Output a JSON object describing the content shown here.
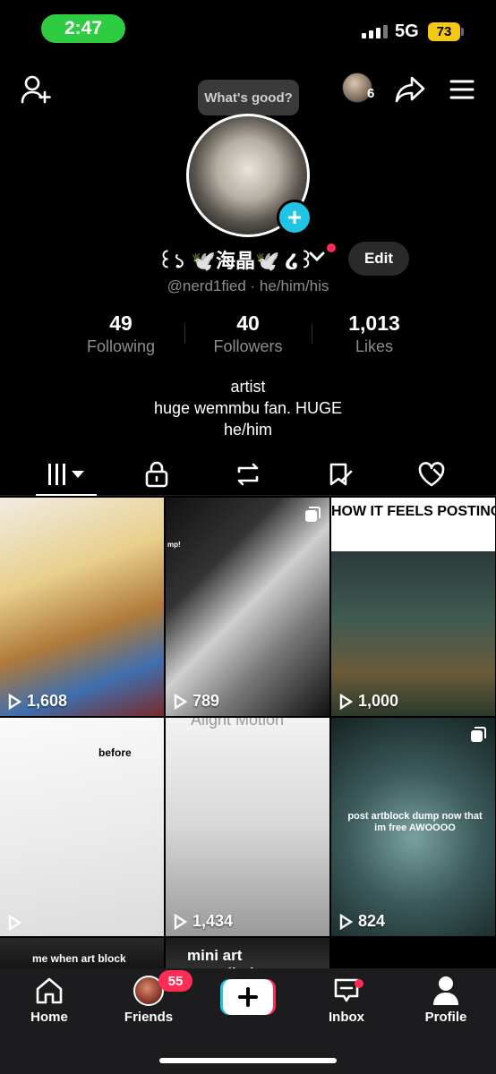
{
  "status_bar": {
    "time": "2:47",
    "network": "5G",
    "battery": "73"
  },
  "header": {
    "tooltip": "What's good?",
    "viewer_count": "6",
    "display_name": "꒰১ 🕊️海晶🕊️ ໒꒱",
    "edit_label": "Edit",
    "handle": "@nerd1fied · he/him/his"
  },
  "stats": [
    {
      "value": "49",
      "label": "Following"
    },
    {
      "value": "40",
      "label": "Followers"
    },
    {
      "value": "1,013",
      "label": "Likes"
    }
  ],
  "bio": [
    "artist",
    "huge wemmbu fan. HUGE",
    "he/him"
  ],
  "tabs": [
    "videos-icon",
    "lock-icon",
    "repost-icon",
    "favorites-icon",
    "liked-icon"
  ],
  "videos": [
    {
      "views": "1,608"
    },
    {
      "views": "789",
      "overlay": "mp!"
    },
    {
      "views": "1,000",
      "overlay": "HOW IT FEELS POSTING AGAIN AFTER A LONG BREAK"
    },
    {
      "views": "",
      "overlay": "before"
    },
    {
      "views": "1,434",
      "overlay": "Alight Motion"
    },
    {
      "views": "824",
      "overlay": "post artblock dump now that im free AWOOOO"
    },
    {
      "views": "",
      "overlay": "me when art block"
    },
    {
      "views": "",
      "overlay": "mini art compilation"
    }
  ],
  "nav": {
    "home": "Home",
    "friends": "Friends",
    "friends_badge": "55",
    "inbox": "Inbox",
    "profile": "Profile"
  },
  "colors": {
    "accent_cyan": "#20c3e4",
    "accent_red": "#ff2d55",
    "status_green": "#2ecc40",
    "battery_yellow": "#f4c915"
  }
}
